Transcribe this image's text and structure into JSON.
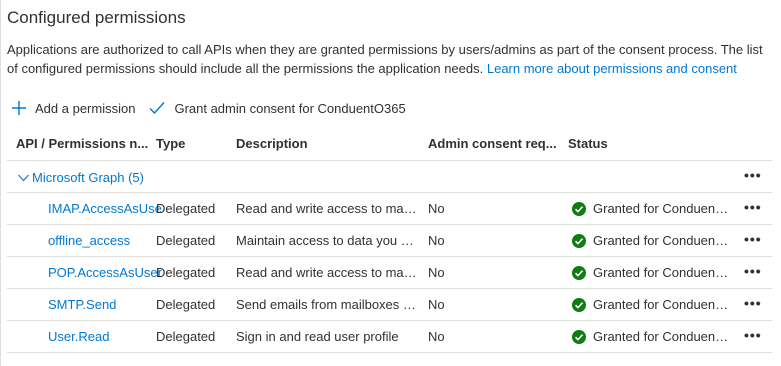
{
  "section": {
    "title": "Configured permissions",
    "description": "Applications are authorized to call APIs when they are granted permissions by users/admins as part of the consent process. The list of configured permissions should include all the permissions the application needs.",
    "learn_more": "Learn more about permissions and consent"
  },
  "toolbar": {
    "add_label": "Add a permission",
    "grant_label": "Grant admin consent for ConduentO365"
  },
  "table": {
    "headers": {
      "api": "API / Permissions n...",
      "type": "Type",
      "description": "Description",
      "admin": "Admin consent req...",
      "status": "Status"
    },
    "group": {
      "label": "Microsoft Graph (5)",
      "more": "•••"
    },
    "rows": [
      {
        "api": "IMAP.AccessAsUse",
        "type": "Delegated",
        "description": "Read and write access to mail...",
        "admin": "No",
        "status": "Granted for ConduentO...",
        "more": "•••"
      },
      {
        "api": "offline_access",
        "type": "Delegated",
        "description": "Maintain access to data you h...",
        "admin": "No",
        "status": "Granted for ConduentO...",
        "more": "•••"
      },
      {
        "api": "POP.AccessAsUser",
        "type": "Delegated",
        "description": "Read and write access to mail...",
        "admin": "No",
        "status": "Granted for ConduentO...",
        "more": "•••"
      },
      {
        "api": "SMTP.Send",
        "type": "Delegated",
        "description": "Send emails from mailboxes u...",
        "admin": "No",
        "status": "Granted for ConduentO...",
        "more": "•••"
      },
      {
        "api": "User.Read",
        "type": "Delegated",
        "description": "Sign in and read user profile",
        "admin": "No",
        "status": "Granted for ConduentO...",
        "more": "•••"
      }
    ]
  },
  "colors": {
    "accent": "#0078d4",
    "success": "#107c10",
    "border": "#e1dfdd",
    "text": "#323130"
  },
  "icons": {
    "add": "plus-icon",
    "grant": "checkmark-icon",
    "status": "success-check-icon",
    "group": "chevron-down-icon",
    "more": "more-icon"
  }
}
